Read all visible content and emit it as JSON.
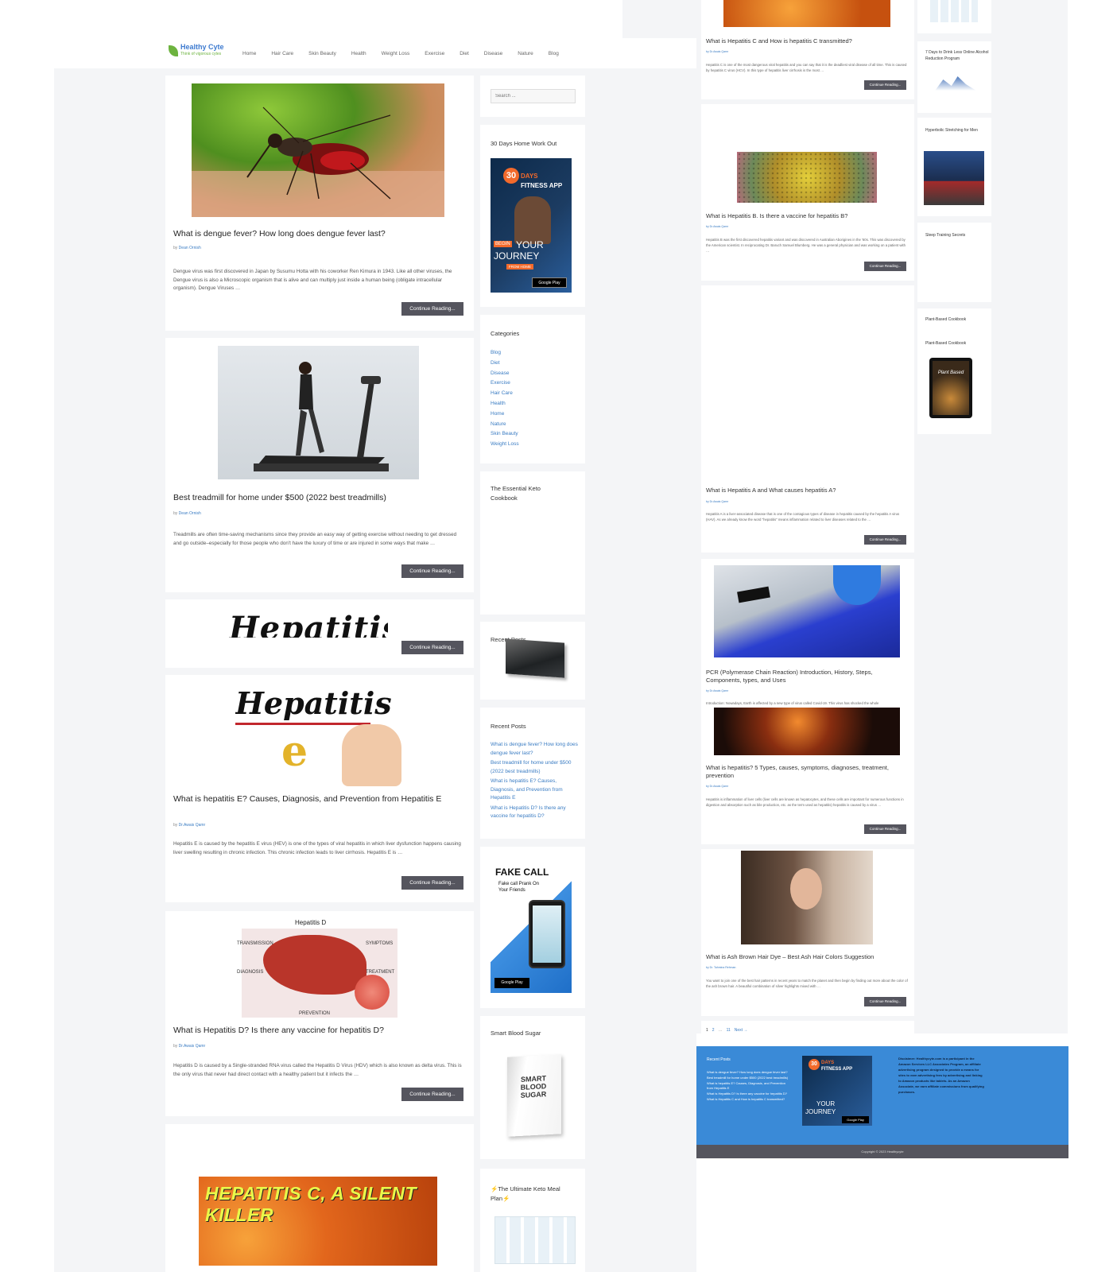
{
  "site": {
    "name": "Healthy Cyte",
    "tagline": "Think of vigorous cytes"
  },
  "nav": [
    "Home",
    "Hair Care",
    "Skin Beauty",
    "Health",
    "Weight Loss",
    "Exercise",
    "Diet",
    "Disease",
    "Nature",
    "Blog"
  ],
  "search": {
    "placeholder": "Search ..."
  },
  "posts": [
    {
      "title": "What is dengue fever? How long does dengue fever last?",
      "by": "by",
      "author": "Dean Ornish",
      "excerpt": "Dengue virus was first discovered in Japan by Susumu Hotta with his coworker Ren Kimura in 1943. Like all other viruses, the Dengue virus is also a Microscopic organism that is alive and can multiply just inside a human being (obligate intracellular organism). Dengue Viruses …",
      "button": "Continue Reading..."
    },
    {
      "title": "Best treadmill for home under $500 (2022 best treadmills)",
      "by": "by",
      "author": "Dean Ornish",
      "excerpt": "Treadmills are often time-saving mechanisms since they provide an easy way of getting exercise without needing to get dressed and go outside–especially for those people who don't have the luxury of time or are injured in some ways that make …",
      "button": "Continue Reading..."
    },
    {
      "image_text": "Hepatitis",
      "button": "Continue Reading..."
    },
    {
      "image_text": "Hepatitis",
      "image_letter": "e",
      "title": "What is hepatitis E? Causes, Diagnosis, and Prevention from Hepatitis E",
      "by": "by",
      "author": "Dr.Awais Qamr",
      "excerpt": "Hepatitis E is caused by the hepatitis E virus (HEV) is one of the types of viral hepatitis in which liver dysfunction happens causing liver swelling resulting in chronic infection. This chronic infection leads to liver cirrhosis. Hepatitis E is …",
      "button": "Continue Reading..."
    },
    {
      "image_labels": [
        "Hepatitis D",
        "TRANSMISSION",
        "SYMPTOMS",
        "DIAGNOSIS",
        "TREATMENT",
        "PREVENTION"
      ],
      "title": "What is Hepatitis D? Is there any vaccine for hepatitis D?",
      "by": "by",
      "author": "Dr.Awais Qamr",
      "excerpt": "Hepatitis D is caused by a Single-stranded RNA virus called the Hepatitis D Virus (HDV) which is also known as delta virus. This is the only virus that never had direct contact with a healthy patient but it infects the …",
      "button": "Continue Reading..."
    },
    {
      "image_text": "HEPATITIS C, A SILENT KILLER"
    }
  ],
  "sidebar": {
    "workout_title": "30 Days Home Work Out",
    "workout_ad": {
      "num": "30",
      "days": "DAYS",
      "app": "FITNESS APP",
      "begin": "BEGIN",
      "your": "YOUR",
      "journey": "JOURNEY",
      "from_home": "FROM HOME",
      "store": "Google Play"
    },
    "categories_title": "Categories",
    "categories": [
      "Blog",
      "Diet",
      "Disease",
      "Exercise",
      "Hair Care",
      "Health",
      "Home",
      "Nature",
      "Skin Beauty",
      "Weight Loss"
    ],
    "keto_title": "The Essential Keto Cookbook",
    "recent_overlap_title": "Recent Posts",
    "recent_title": "Recent Posts",
    "recent": [
      "What is dengue fever? How long does dengue fever last?",
      "Best treadmill for home under $500 (2022 best treadmills)",
      "What is hepatitis E? Causes, Diagnosis, and Prevention from Hepatitis E",
      "What is Hepatitis D? Is there any vaccine for hepatitis D?"
    ],
    "fakecall": {
      "title": "FAKE CALL",
      "sub": "Fake call Prank On Your Friends",
      "store": "Google Play"
    },
    "blood_title": "Smart Blood Sugar",
    "blood_book": "SMART BLOOD SUGAR",
    "keto_plan_title": "⚡The Ultimate Keto Meal Plan⚡"
  },
  "right_posts": [
    {
      "title": "What is Hepatitis C and How is hepatitis C transmitted?",
      "by": "by Dr.Awais Qamr",
      "excerpt": "Hepatitis C is one of the most dangerous viral hepatitis and you can say that it is the deadliest viral disease of all time. This is caused by hepatitis C virus (HCV). In this type of hepatitis liver cirrhosis is the most …",
      "button": "Continue Reading..."
    },
    {
      "title": "What is Hepatitis B. Is there a vaccine for hepatitis B?",
      "by": "by Dr.Awais Qamr",
      "excerpt": "Hepatitis B was the first discovered hepatitis variant and was discovered in Australian Aborigines in the '60s. This was discovered by the American scientist. In reciprocating Dr. Baruch Samuel Blumberg. He was a general physician and was working on a patient with …",
      "button": "Continue Reading..."
    },
    {
      "title": "What is Hepatitis A and What causes hepatitis A?",
      "by": "by Dr.Awais Qamr",
      "excerpt": "Hepatitis A is a liver-associated disease that is one of the contagious types of disease in hepatitis caused by the hepatitis A virus (HAV). As we already know the word \"hepatitis\" means inflammation related to liver diseases related to the …",
      "button": "Continue Reading..."
    },
    {
      "title": "PCR (Polymerase Chain Reaction) Introduction, History, Steps, Components, types, and Uses",
      "by": "by Dr.Awais Qamr",
      "excerpt": "Introduction: Nowadays, Earth is affected by a new type of virus called Covid-19. This virus has shocked the whole",
      "button": ""
    },
    {
      "title": "What is hepatitis? 5 Types, causes, symptoms, diagnoses, treatment, prevention",
      "by": "by Dr.Awais Qamr",
      "excerpt": "Hepatitis is inflammation of liver cells (liver cells are known as hepatocytes, and these cells are important for numerous functions in digestion and absorption such as bile production, etc. as the term used as hepatitis) hepatitis is caused by a virus …",
      "button": "Continue Reading..."
    },
    {
      "title": "What is Ash Brown Hair Dye – Best Ash Hair Colors Suggestion",
      "by": "by Dr. Tahmina Rehman",
      "excerpt": "You want to join one of the best hair patterns in recent years to match the planet and then begin by finding out more about the color of the ash brown hair. A beautiful combination of silver highlights mixed with …",
      "button": "Continue Reading..."
    }
  ],
  "pagination": [
    "1",
    "2",
    "…",
    "11",
    "Next →"
  ],
  "right_sidebar": {
    "alcohol_title": "7 Days to Drink Less Online Alcohol Reduction Program",
    "stretch_title": "Hyperbolic Stretching for Men",
    "sleep_title": "Sleep Training Secrets",
    "plant_title_1": "Plant-Based Cookbook",
    "plant_title_2": "Plant-Based Cookbook",
    "plant_book": "Plant Based"
  },
  "footer": {
    "recent_title": "Recent Posts",
    "recent": [
      "What is dengue fever? How long does dengue fever last?",
      "Best treadmill for home under $500 (2022 best treadmills)",
      "What is hepatitis E? Causes, Diagnosis, and Prevention from Hepatitis E",
      "What is Hepatitis D? Is there any vaccine for hepatitis D?",
      "What is Hepatitis C and How is hepatitis C transmitted?"
    ],
    "disclaimer": "Disclaimer: Healthycyte.com is a participant in the Amazon Services LLC Associates Program, an affiliate advertising program designed to provide a means for sites to earn advertising fees by advertising and linking to Amazon products like tablets. As an Amazon Associate, we earn affiliate commissions from qualifying purchases.",
    "copyright": "Copyright © 2023 Healthycyte"
  },
  "colors": {
    "accent": "#3a7cc3",
    "button": "#55555e",
    "footer": "#3a8ad7",
    "page_bg": "#f4f5f7"
  }
}
